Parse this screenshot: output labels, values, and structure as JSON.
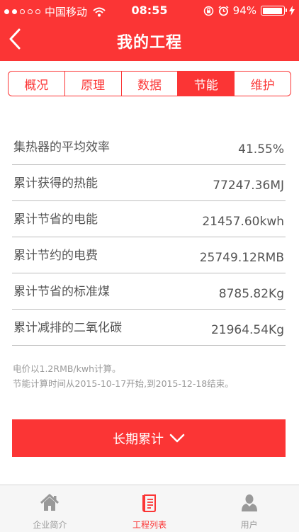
{
  "status_bar": {
    "carrier": "中国移动",
    "time": "08:55",
    "battery": "94%",
    "battery_level": 0.94
  },
  "nav": {
    "title": "我的工程"
  },
  "tabs": [
    {
      "label": "概况",
      "active": false
    },
    {
      "label": "原理",
      "active": false
    },
    {
      "label": "数据",
      "active": false
    },
    {
      "label": "节能",
      "active": true
    },
    {
      "label": "维护",
      "active": false
    }
  ],
  "metrics": [
    {
      "label": "集热器的平均效率",
      "value": "41.55%"
    },
    {
      "label": "累计获得的热能",
      "value": "77247.36MJ"
    },
    {
      "label": "累计节省的电能",
      "value": "21457.60kwh"
    },
    {
      "label": "累计节约的电费",
      "value": "25749.12RMB"
    },
    {
      "label": "累计节省的标准煤",
      "value": "8785.82Kg"
    },
    {
      "label": "累计减排的二氧化碳",
      "value": "21964.54Kg"
    }
  ],
  "notes": {
    "line1": "电价以1.2RMB/kwh计算。",
    "line2": "节能计算时间从2015-10-17开始,到2015-12-18结束。"
  },
  "period_button": {
    "label": "长期累计"
  },
  "tabbar": [
    {
      "label": "企业简介",
      "icon": "home-icon",
      "active": false
    },
    {
      "label": "工程列表",
      "icon": "list-icon",
      "active": true
    },
    {
      "label": "用户",
      "icon": "user-icon",
      "active": false
    }
  ],
  "colors": {
    "primary": "#fb3535",
    "divider": "#bdbdbd",
    "text": "#555555",
    "note": "#999999"
  }
}
